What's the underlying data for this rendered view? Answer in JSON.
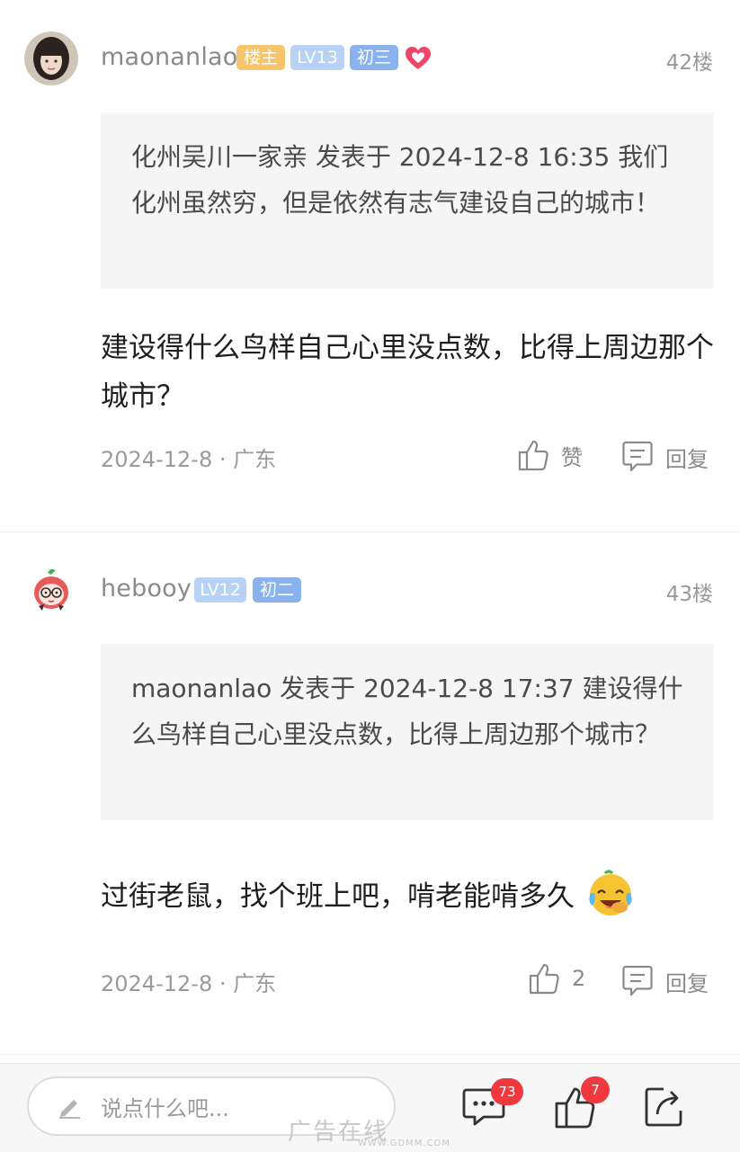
{
  "posts": [
    {
      "username": "maonanlao",
      "badges": [
        "楼主",
        "LV13",
        "初三"
      ],
      "floor": "42楼",
      "quote": "化州吴川一家亲 发表于 2024-12-8 16:35 我们化州虽然穷，但是依然有志气建设自己的城市！",
      "content": "建设得什么鸟样自己心里没点数，比得上周边那个城市？",
      "date_location": "2024-12-8 · 广东",
      "like_label": "赞",
      "reply_label": "回复"
    },
    {
      "username": "hebooy",
      "badges": [
        "LV12",
        "初二"
      ],
      "floor": "43楼",
      "quote": "maonanlao 发表于 2024-12-8 17:37 建设得什么鸟样自己心里没点数，比得上周边那个城市？",
      "content": "过街老鼠，找个班上吧，啃老能啃多久",
      "date_location": "2024-12-8 · 广东",
      "like_label": "2",
      "reply_label": "回复"
    }
  ],
  "bottom_bar": {
    "input_placeholder": "说点什么吧...",
    "comment_count": "73",
    "like_count": "7"
  },
  "watermark": {
    "text": "广告在线",
    "url": "WWW.GDMM.COM"
  },
  "colors": {
    "badge_host": "#f7c46b",
    "badge_level": "#b7d2f4",
    "badge_grade": "#8ab3ee",
    "notification": "#f0383e"
  }
}
